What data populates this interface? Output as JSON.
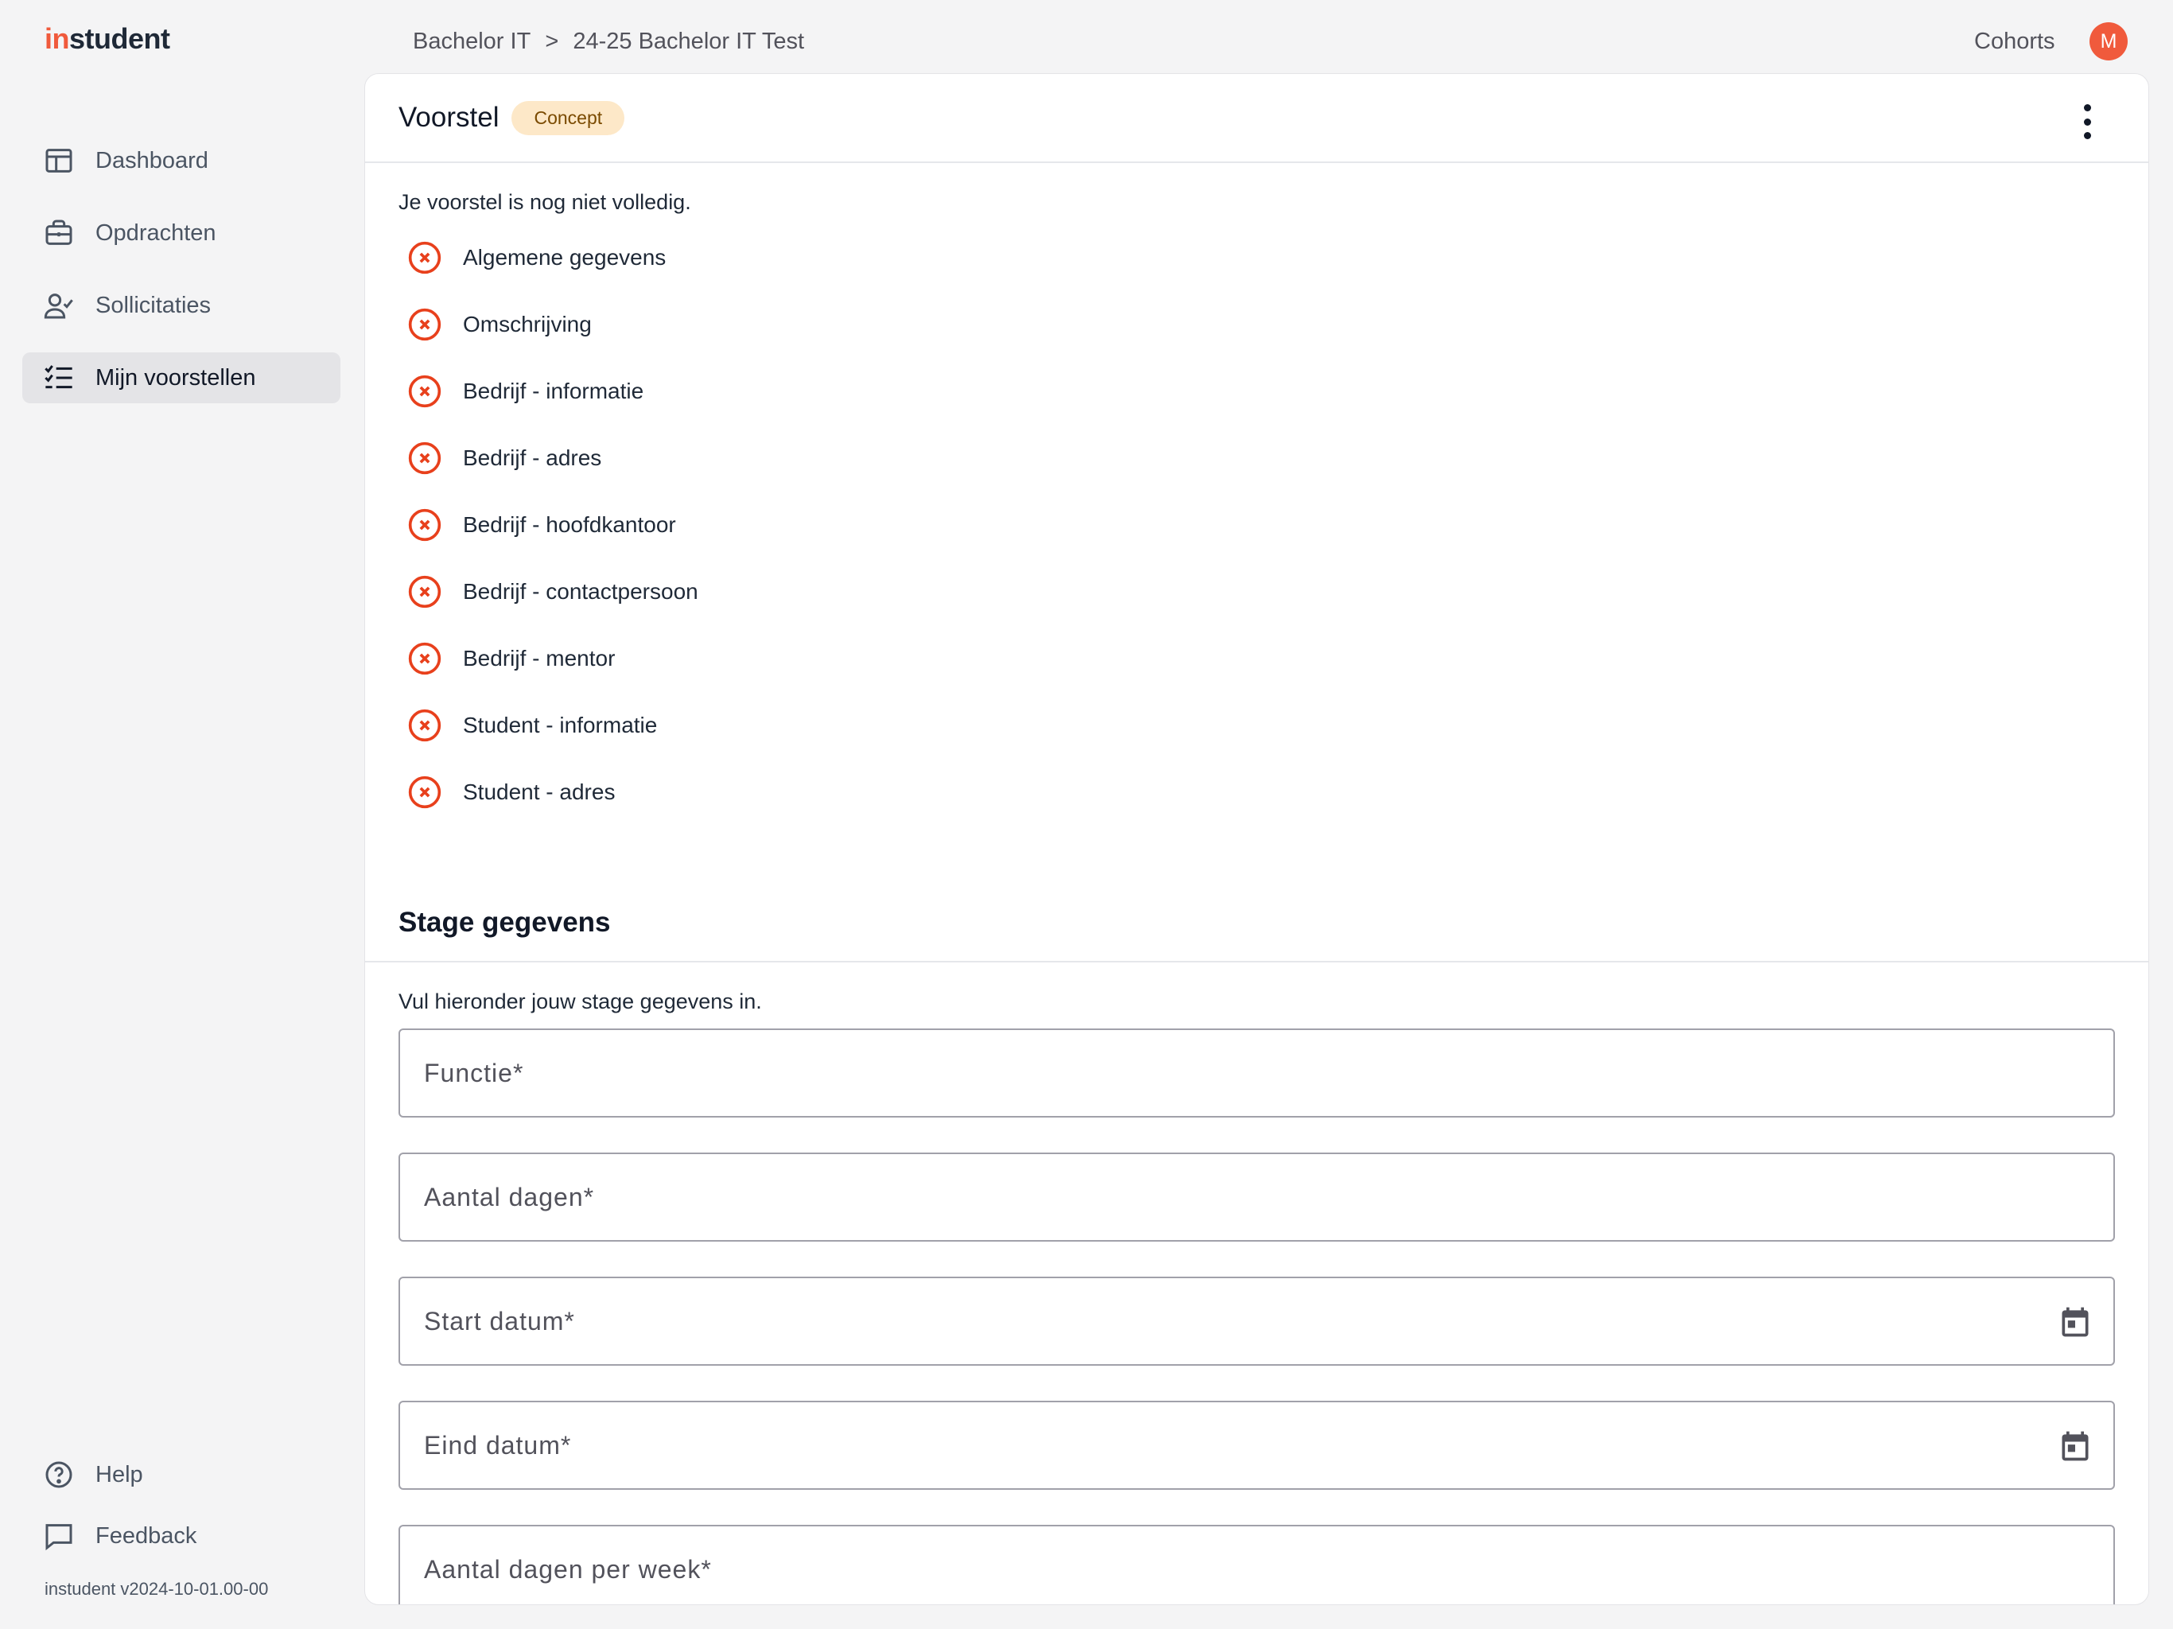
{
  "brand": {
    "logo_prefix": "in",
    "logo_rest": "student"
  },
  "breadcrumb": [
    "Bachelor IT",
    ">",
    "24-25 Bachelor IT Test"
  ],
  "topbar": {
    "cohorts": "Cohorts",
    "avatar_initial": "M"
  },
  "sidebar": {
    "items": [
      {
        "label": "Dashboard",
        "icon": "layout-icon"
      },
      {
        "label": "Opdrachten",
        "icon": "briefcase-icon"
      },
      {
        "label": "Sollicitaties",
        "icon": "user-check-icon"
      },
      {
        "label": "Mijn voorstellen",
        "icon": "list-check-icon",
        "active": true
      }
    ],
    "bottom": [
      {
        "label": "Help",
        "icon": "help-circle-icon"
      },
      {
        "label": "Feedback",
        "icon": "message-square-icon"
      }
    ],
    "version": "instudent v2024-10-01.00-00"
  },
  "card": {
    "title": "Voorstel",
    "status_badge": "Concept",
    "intro": "Je voorstel is nog niet volledig.",
    "checklist": [
      "Algemene gegevens",
      "Omschrijving",
      "Bedrijf - informatie",
      "Bedrijf - adres",
      "Bedrijf - hoofdkantoor",
      "Bedrijf - contactpersoon",
      "Bedrijf - mentor",
      "Student - informatie",
      "Student - adres"
    ],
    "section_title": "Stage gegevens",
    "section_intro": "Vul hieronder jouw stage gegevens in.",
    "fields": {
      "functie": {
        "placeholder": "Functie*",
        "value": ""
      },
      "aantal_dagen": {
        "placeholder": "Aantal dagen*",
        "value": ""
      },
      "start_datum": {
        "placeholder": "Start datum*",
        "value": ""
      },
      "eind_datum": {
        "placeholder": "Eind datum*",
        "value": ""
      },
      "dagen_per_week": {
        "placeholder": "Aantal dagen per week*",
        "value": ""
      }
    }
  },
  "colors": {
    "accent": "#f05a3c",
    "badge_bg": "#fde8c8",
    "error": "#e8401c"
  }
}
